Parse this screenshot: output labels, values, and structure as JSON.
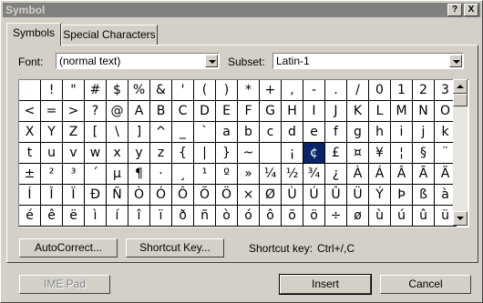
{
  "window": {
    "title": "Symbol",
    "help_btn": "?",
    "close_btn": "X"
  },
  "tabs": [
    {
      "label": "Symbols"
    },
    {
      "label": "Special Characters"
    }
  ],
  "font": {
    "label": "Font:",
    "value": "(normal text)"
  },
  "subset": {
    "label": "Subset:",
    "value": "Latin-1"
  },
  "grid": {
    "selected": "¢",
    "rows": [
      [
        " ",
        "!",
        "\"",
        "#",
        "$",
        "%",
        "&",
        "'",
        "(",
        ")",
        "*",
        "+",
        ",",
        "-",
        ".",
        "/",
        "0",
        "1",
        "2",
        "3"
      ],
      [
        "<",
        "=",
        ">",
        "?",
        "@",
        "A",
        "B",
        "C",
        "D",
        "E",
        "F",
        "G",
        "H",
        "I",
        "J",
        "K",
        "L",
        "M",
        "N",
        "O"
      ],
      [
        "X",
        "Y",
        "Z",
        "[",
        "\\",
        "]",
        "^",
        "_",
        "`",
        "a",
        "b",
        "c",
        "d",
        "e",
        "f",
        "g",
        "h",
        "i",
        "j",
        "k"
      ],
      [
        "t",
        "u",
        "v",
        "w",
        "x",
        "y",
        "z",
        "{",
        "|",
        "}",
        "~",
        " ",
        "¡",
        "¢",
        "£",
        "¤",
        "¥",
        "¦",
        "§",
        "¨"
      ],
      [
        "±",
        "²",
        "³",
        "´",
        "µ",
        "¶",
        "·",
        "¸",
        "¹",
        "º",
        "»",
        "¼",
        "½",
        "¾",
        "¿",
        "À",
        "Á",
        "Â",
        "Ã",
        "Ä"
      ],
      [
        "Í",
        "Î",
        "Ï",
        "Ð",
        "Ñ",
        "Ò",
        "Ó",
        "Ô",
        "Õ",
        "Ö",
        "×",
        "Ø",
        "Ù",
        "Ú",
        "Û",
        "Ü",
        "Ý",
        "Þ",
        "ß",
        "à"
      ],
      [
        "é",
        "ê",
        "ë",
        "ì",
        "í",
        "î",
        "ï",
        "ð",
        "ñ",
        "ò",
        "ó",
        "ô",
        "õ",
        "ö",
        "÷",
        "ø",
        "ù",
        "ú",
        "û",
        "ü"
      ]
    ]
  },
  "buttons": {
    "autocorrect": "AutoCorrect...",
    "shortcut_key": "Shortcut Key...",
    "ime_pad": "IME Pad",
    "insert": "Insert",
    "cancel": "Cancel"
  },
  "shortcut": {
    "label": "Shortcut key:",
    "value": "Ctrl+/,C"
  }
}
